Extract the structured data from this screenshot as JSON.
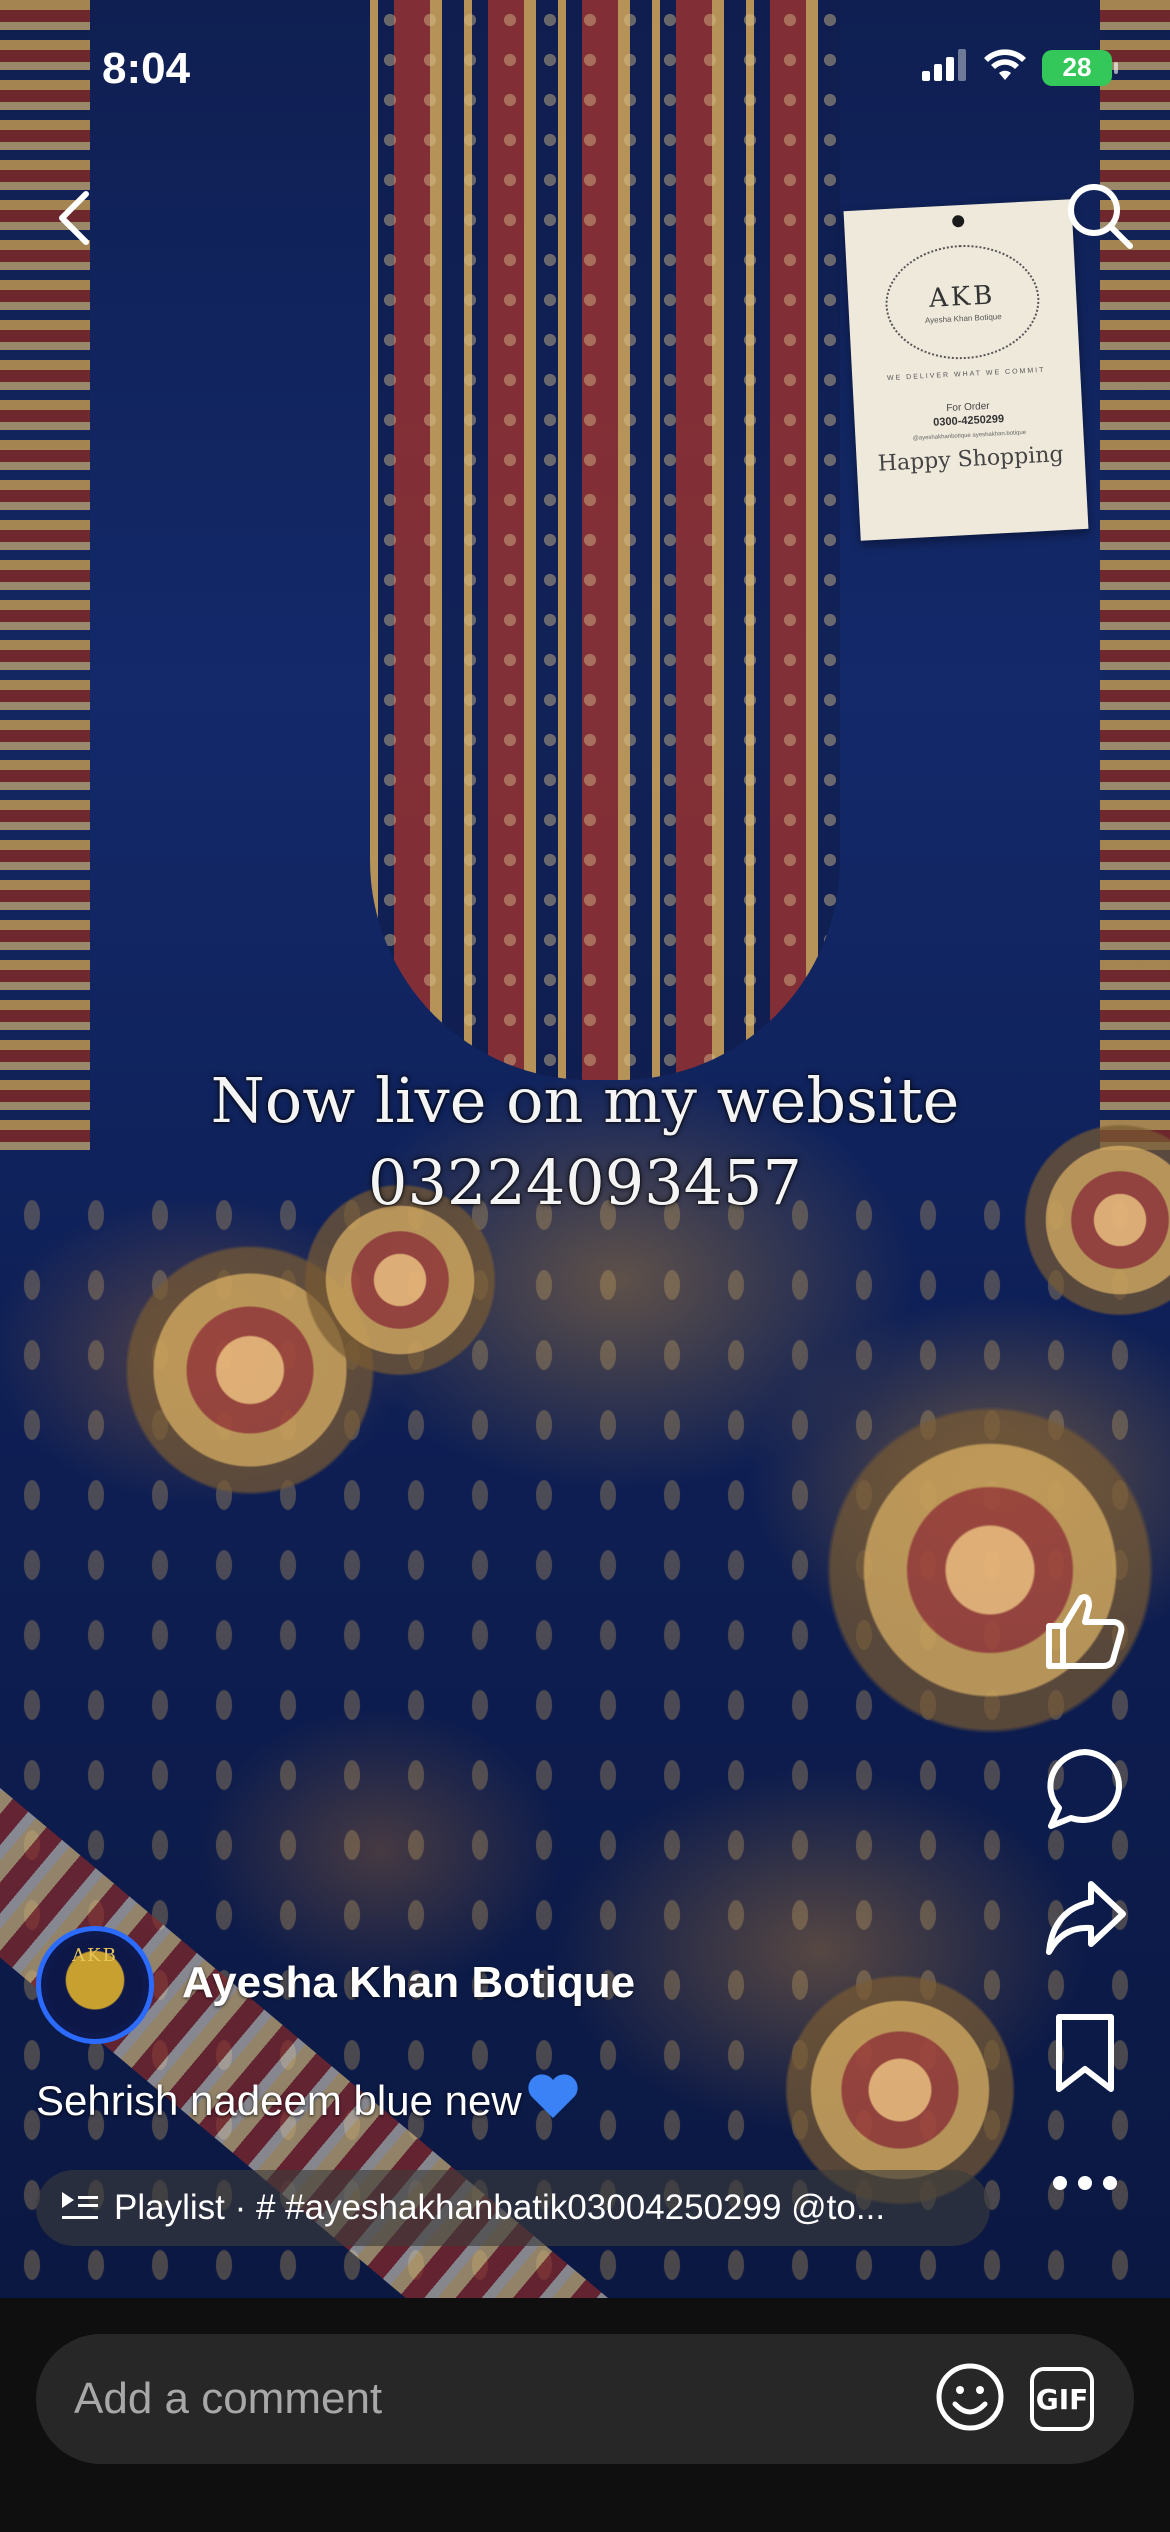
{
  "status_bar": {
    "time": "8:04",
    "battery": "28"
  },
  "video": {
    "overlay_line1": "Now live on my website",
    "overlay_line2": "03224093457",
    "tag": {
      "logo": "AKB",
      "logo_sub": "Ayesha Khan Botique",
      "motto": "WE DELIVER WHAT WE COMMIT",
      "order_label": "For Order",
      "phone": "0300-4250299",
      "social": "@ayeshakhanbotique   ayeshakhan.botique",
      "happy": "Happy Shopping"
    }
  },
  "channel": {
    "name": "Ayesha Khan Botique",
    "avatar_text": "AKB"
  },
  "caption": {
    "text": "Sehrish nadeem blue new"
  },
  "playlist": {
    "text": "Playlist · #  #ayeshakhanbatik03004250299  @to..."
  },
  "comment": {
    "placeholder": "Add a comment",
    "gif_label": "GIF"
  },
  "icons": {
    "back": "back-chevron-icon",
    "search": "search-icon",
    "like": "thumbs-up-icon",
    "comment": "comment-bubble-icon",
    "share": "share-arrow-icon",
    "save": "bookmark-icon",
    "more": "more-dots-icon",
    "emoji": "emoji-icon",
    "playlist": "playlist-icon",
    "heart": "blue-heart-emoji"
  },
  "colors": {
    "avatar_ring": "#2c6bff",
    "battery": "#34c759",
    "heart": "#3b82f6"
  }
}
